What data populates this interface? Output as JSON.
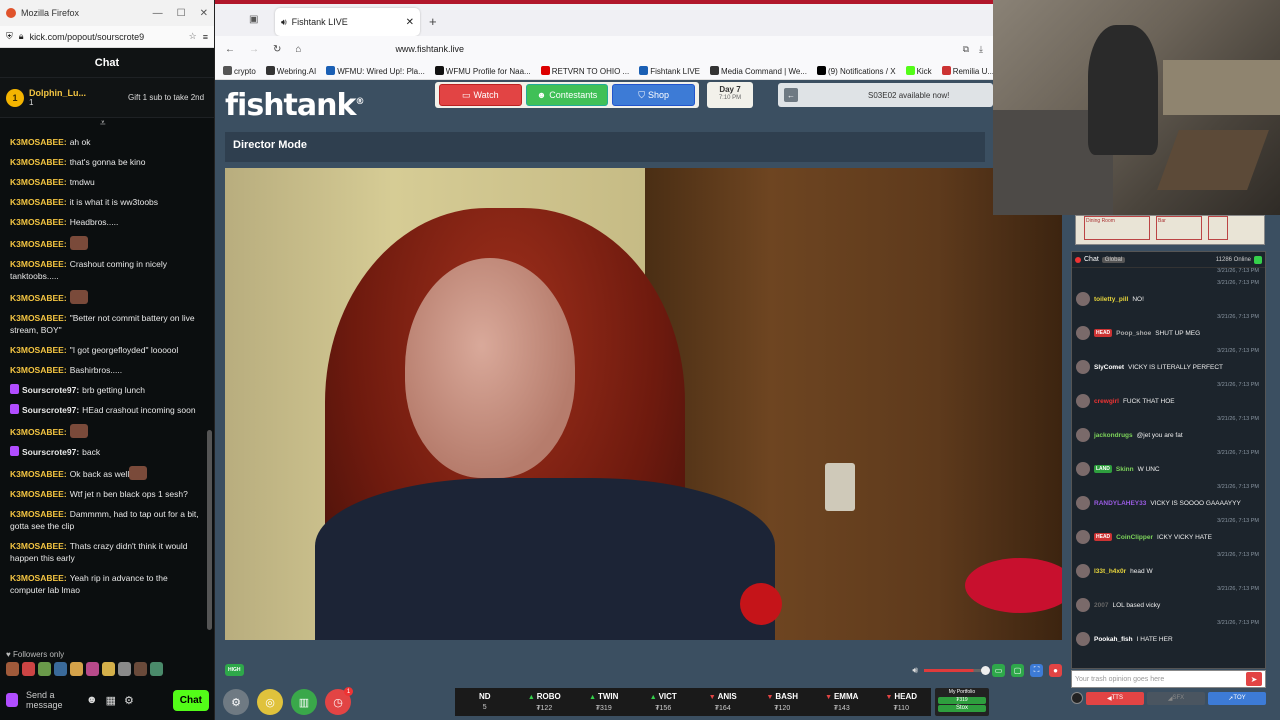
{
  "kick_window": {
    "title": "Mozilla Firefox",
    "url": "kick.com/popout/sourscrote9",
    "header": "Chat",
    "pinned": {
      "user": "Dolphin_Lu...",
      "count": "1",
      "gift_text": "Gift 1 sub to take 2nd",
      "badge": "1"
    },
    "messages": [
      {
        "user": "K3MOSABEE:",
        "text": "ah ok"
      },
      {
        "user": "K3MOSABEE:",
        "text": "that's gonna be kino"
      },
      {
        "user": "K3MOSABEE:",
        "text": "tmdwu"
      },
      {
        "user": "K3MOSABEE:",
        "text": "it is what it is ww3toobs"
      },
      {
        "user": "K3MOSABEE:",
        "text": "Headbros....."
      },
      {
        "user": "K3MOSABEE:",
        "text": "",
        "emote": true
      },
      {
        "user": "K3MOSABEE:",
        "text": "Crashout coming in nicely tanktoobs....."
      },
      {
        "user": "K3MOSABEE:",
        "text": "",
        "emote": true
      },
      {
        "user": "K3MOSABEE:",
        "text": "\"Better not commit battery on live stream, BOY\""
      },
      {
        "user": "K3MOSABEE:",
        "text": "\"I got georgefloyded\" loooool"
      },
      {
        "user": "K3MOSABEE:",
        "text": "Bashirbros....."
      },
      {
        "user": "Sourscrote97:",
        "text": "brb getting lunch",
        "badge": true
      },
      {
        "user": "Sourscrote97:",
        "text": "HEad crashout incoming soon",
        "badge": true
      },
      {
        "user": "K3MOSABEE:",
        "text": "",
        "emote": true
      },
      {
        "user": "Sourscrote97:",
        "text": "back",
        "badge": true
      },
      {
        "user": "K3MOSABEE:",
        "text": "Ok back as well",
        "emote": true
      },
      {
        "user": "K3MOSABEE:",
        "text": "Wtf jet n ben black ops 1 sesh?"
      },
      {
        "user": "K3MOSABEE:",
        "text": "Dammmm, had to tap out for a bit, gotta see the clip"
      },
      {
        "user": "K3MOSABEE:",
        "text": "Thats crazy didn't think it would happen this early"
      },
      {
        "user": "K3MOSABEE:",
        "text": "Yeah rip in advance to the computer lab lmao"
      }
    ],
    "followers_only": "Followers only",
    "input_placeholder": "Send a message",
    "chat_button": "Chat"
  },
  "browser": {
    "tab_title": "Fishtank LIVE",
    "url": "www.fishtank.live",
    "bookmarks": [
      "crypto",
      "Webring.AI",
      "WFMU: Wired Up!: Pla...",
      "WFMU Profile for Naa...",
      "RETVRN TO OHIO ...",
      "Fishtank LIVE",
      "Media Command | We...",
      "(9) Notifications / X",
      "Kick",
      "Remilia U..."
    ]
  },
  "fishtank": {
    "logo": "fishtank",
    "nav": {
      "watch": "Watch",
      "contestants": "Contestants",
      "shop": "Shop"
    },
    "day": {
      "label": "Day 7",
      "time": "7:10 PM"
    },
    "banner": "S03E02 available now!",
    "mode": "Director Mode",
    "hq_label": "HIGH",
    "notif_count": "1",
    "ticker": [
      {
        "name": "ND",
        "dir": "",
        "value": "5"
      },
      {
        "name": "ROBO",
        "dir": "up",
        "value": "₮122"
      },
      {
        "name": "TWIN",
        "dir": "up",
        "value": "₮319"
      },
      {
        "name": "VICT",
        "dir": "up",
        "value": "₮156"
      },
      {
        "name": "ANIS",
        "dir": "dn",
        "value": "₮164"
      },
      {
        "name": "BASH",
        "dir": "dn",
        "value": "₮120"
      },
      {
        "name": "EMMA",
        "dir": "dn",
        "value": "₮143"
      },
      {
        "name": "HEAD",
        "dir": "dn",
        "value": "₮110"
      }
    ],
    "portfolio": {
      "title": "My Portfolio",
      "balance": "₮319",
      "stox": "Stox"
    }
  },
  "right_chat": {
    "minimap": [
      "Dining Room",
      "Bar"
    ],
    "tab_chat": "Chat",
    "tab_global": "Global",
    "online": "11286 Online",
    "timestamp": "3/21/26, 7:13 PM",
    "messages": [
      {
        "user": "toiletty_pill",
        "text": "NO!",
        "color": "#e7d53c"
      },
      {
        "user": "Poop_shoe",
        "text": "SHUT UP MEG",
        "color": "#aaaaaa",
        "tag": "HEAD",
        "tag_color": "#c33"
      },
      {
        "user": "SlyComet",
        "text": "VICKY IS LITERALLY PERFECT",
        "color": "#ffffff"
      },
      {
        "user": "crewgirl",
        "text": "FUCK THAT HOE",
        "color": "#e33"
      },
      {
        "user": "jackondrugs",
        "text": "@jet you are fat",
        "color": "#7cd35a"
      },
      {
        "user": "Skinn",
        "text": "W UNC",
        "color": "#7cd35a",
        "tag": "LAND",
        "tag_color": "#2e9e3e"
      },
      {
        "user": "RANDYLAHEY33",
        "text": "VICKY IS SOOOO GAAAAYYY",
        "color": "#9a5be3"
      },
      {
        "user": "CoinClipper",
        "text": "ICKY VICKY HATE",
        "color": "#7cd35a",
        "tag": "HEAD",
        "tag_color": "#c33"
      },
      {
        "user": "l33t_h4x0r",
        "text": "head W",
        "color": "#e7d53c"
      },
      {
        "user": "2007",
        "text": "LOL based vicky",
        "color": "#666666"
      },
      {
        "user": "Pookah_fish",
        "text": "I HATE HER",
        "color": "#ffffff"
      }
    ],
    "input_placeholder": "Your trash opinion goes here",
    "buttons": {
      "tts": "TTS",
      "sfx": "SFX",
      "toy": "TOY"
    }
  }
}
